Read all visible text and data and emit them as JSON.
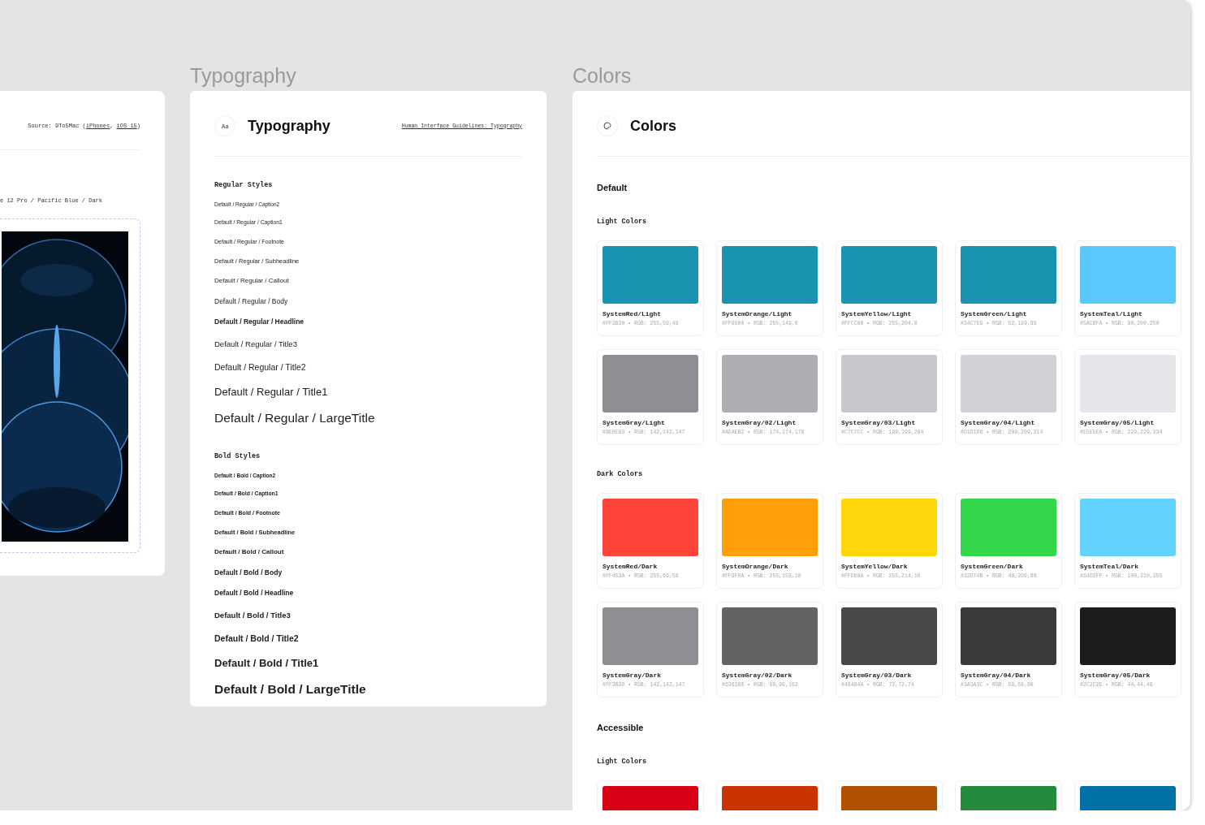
{
  "left_panel": {
    "source": [
      {
        "kind": "text",
        "text": "Source: 9To5Mac ("
      },
      {
        "kind": "link",
        "text": "iPhones"
      },
      {
        "kind": "text",
        "text": ", "
      },
      {
        "kind": "link",
        "text": "iOS 15"
      },
      {
        "kind": "text",
        "text": ")"
      }
    ],
    "caption": "e 12 Pro / Pacific Blue / Dark"
  },
  "typography": {
    "label": "Typography",
    "icon_text": "Aa",
    "title": "Typography",
    "link": "Human Interface Guidelines: Typography",
    "sections": [
      {
        "title": "Regular Styles",
        "kind": "regular",
        "items": [
          "Default / Regular / Caption2",
          "Default / Regular / Caption1",
          "Default / Regular / Footnote",
          "Default / Regular / Subheadline",
          "Default / Regular / Callout",
          "Default / Regular / Body",
          "Default / Regular / Headline",
          "Default / Regular / Title3",
          "Default / Regular / Title2",
          "Default / Regular / Title1",
          "Default / Regular / LargeTitle"
        ]
      },
      {
        "title": "Bold Styles",
        "kind": "bold",
        "items": [
          "Default / Bold / Caption2",
          "Default / Bold / Caption1",
          "Default / Bold / Footnote",
          "Default / Bold / Subheadline",
          "Default / Bold / Callout",
          "Default / Bold / Body",
          "Default / Bold / Headline",
          "Default / Bold / Title3",
          "Default / Bold / Title2",
          "Default / Bold / Title1",
          "Default / Bold / LargeTitle"
        ]
      }
    ]
  },
  "colors": {
    "label": "Colors",
    "title": "Colors",
    "sections": [
      {
        "title": "Default",
        "groups": [
          {
            "title": "Light Colors",
            "swatches": [
              {
                "name": "SystemRed/Light",
                "code": "#FF3B30 • RGB: 255,59,48",
                "color": "#1a93b0"
              },
              {
                "name": "SystemOrange/Light",
                "code": "#FF9500 • RGB: 255,149,0",
                "color": "#1a93b0"
              },
              {
                "name": "SystemYellow/Light",
                "code": "#FFCC00 • RGB: 255,204,0",
                "color": "#1a93b0"
              },
              {
                "name": "SystemGreen/Light",
                "code": "#34C759 • RGB: 52,199,89",
                "color": "#1a93b0"
              },
              {
                "name": "SystemTeal/Light",
                "code": "#5AC8FA • RGB: 90,200,250",
                "color": "#5ac8fa"
              },
              {
                "name": "SystemGray/Light",
                "code": "#8E8E93 • RGB: 142,142,147",
                "color": "#8e8e93"
              },
              {
                "name": "SystemGray/02/Light",
                "code": "#AEAEB2 • RGB: 174,174,178",
                "color": "#aeaeb2"
              },
              {
                "name": "SystemGray/03/Light",
                "code": "#C7C7CC • RGB: 199,199,204",
                "color": "#c7c7cc"
              },
              {
                "name": "SystemGray/04/Light",
                "code": "#D1D1D6 • RGB: 209,209,214",
                "color": "#d1d1d6"
              },
              {
                "name": "SystemGray/05/Light",
                "code": "#E5E5EA • RGB: 229,229,234",
                "color": "#e5e5ea"
              }
            ]
          },
          {
            "title": "Dark Colors",
            "swatches": [
              {
                "name": "SystemRed/Dark",
                "code": "#FF453A • RGB: 255,69,58",
                "color": "#ff453a"
              },
              {
                "name": "SystemOrange/Dark",
                "code": "#FF9F0A • RGB: 255,159,10",
                "color": "#ff9f0a"
              },
              {
                "name": "SystemYellow/Dark",
                "code": "#FFD60A • RGB: 255,214,10",
                "color": "#ffd60a"
              },
              {
                "name": "SystemGreen/Dark",
                "code": "#32D74B • RGB: 48,209,88",
                "color": "#32d74b"
              },
              {
                "name": "SystemTeal/Dark",
                "code": "#64D2FF • RGB: 100,210,255",
                "color": "#64d2ff"
              },
              {
                "name": "SystemGray/Dark",
                "code": "#FF3B30 • RGB: 142,142,147",
                "color": "#8e8e93"
              },
              {
                "name": "SystemGray/02/Dark",
                "code": "#636366 • RGB: 99,99,102",
                "color": "#636366"
              },
              {
                "name": "SystemGray/03/Dark",
                "code": "#48484A • RGB: 72,72,74",
                "color": "#48484a"
              },
              {
                "name": "SystemGray/04/Dark",
                "code": "#3A3A3C • RGB: 58,58,60",
                "color": "#3a3a3c"
              },
              {
                "name": "SystemGray/05/Dark",
                "code": "#2C2C2E • RGB: 44,44,46",
                "color": "#1c1c1e"
              }
            ]
          }
        ]
      },
      {
        "title": "Accessible",
        "groups": [
          {
            "title": "Light Colors",
            "swatches": [
              {
                "color": "#d70015"
              },
              {
                "color": "#c93400"
              },
              {
                "color": "#b25000"
              },
              {
                "color": "#248a3d"
              },
              {
                "color": "#0071a4"
              }
            ]
          }
        ]
      }
    ]
  }
}
